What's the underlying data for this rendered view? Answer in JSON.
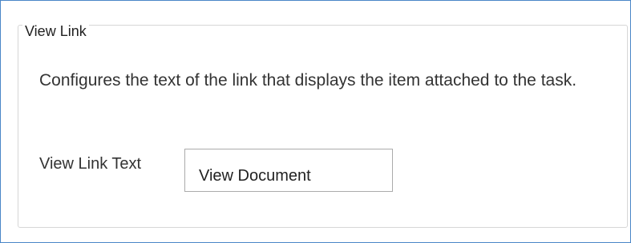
{
  "section": {
    "legend": "View Link",
    "description": "Configures the text of the link that displays the item attached to the task."
  },
  "field": {
    "label": "View Link Text",
    "value": "View Document"
  },
  "colors": {
    "outer_border": "#4a86c8",
    "group_border": "#d6d6d6",
    "input_border": "#ababab",
    "text": "#333333"
  }
}
